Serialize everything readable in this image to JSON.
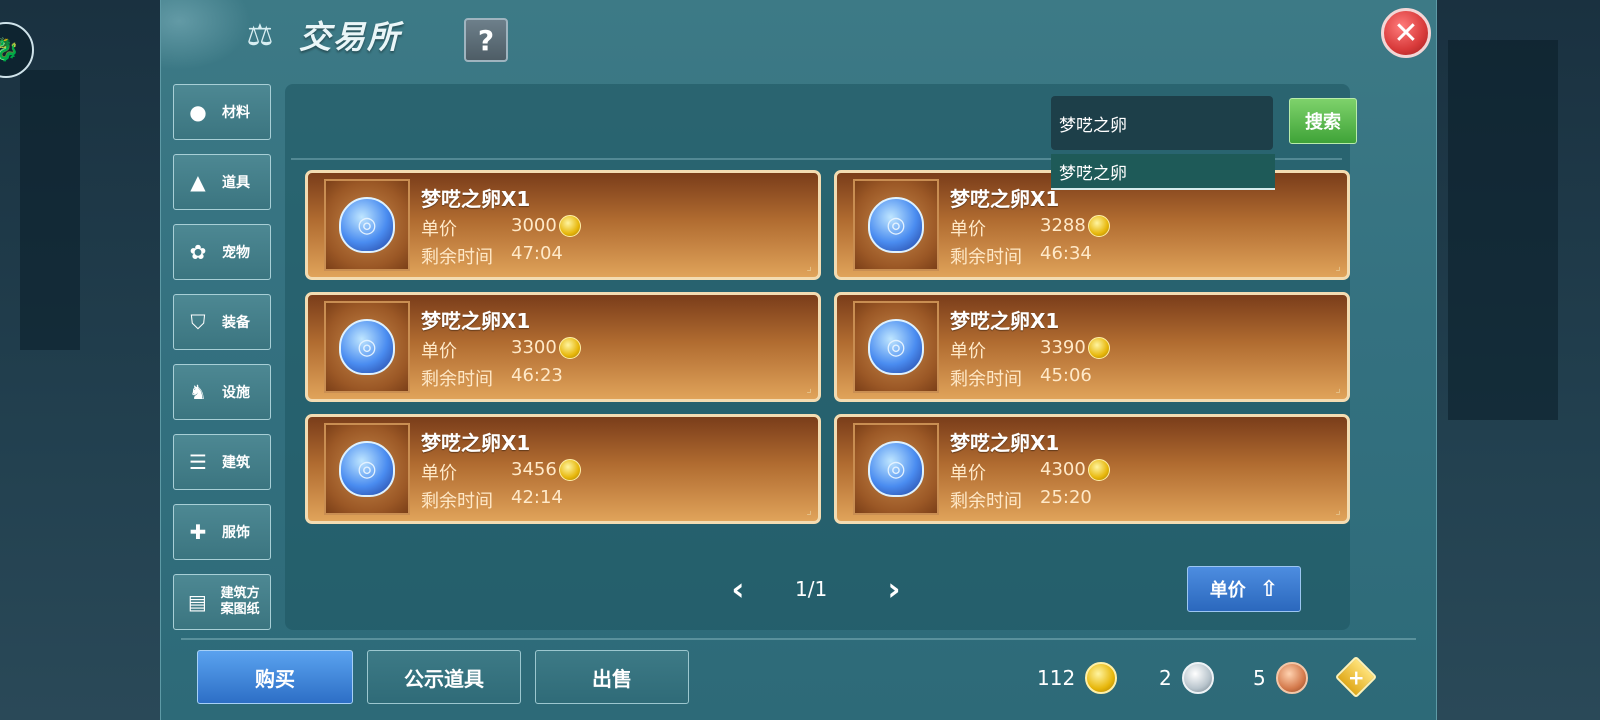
{
  "header": {
    "title": "交易所",
    "help_label": "?",
    "close_label": "✕"
  },
  "categories": [
    {
      "label": "材料",
      "icon": "materials-icon"
    },
    {
      "label": "道具",
      "icon": "item-flask-icon"
    },
    {
      "label": "宠物",
      "icon": "paw-icon"
    },
    {
      "label": "装备",
      "icon": "equipment-icon"
    },
    {
      "label": "设施",
      "icon": "facility-icon"
    },
    {
      "label": "建筑",
      "icon": "building-icon"
    },
    {
      "label": "服饰",
      "icon": "clothing-icon"
    },
    {
      "label": "建筑方案图纸",
      "icon": "blueprint-icon"
    }
  ],
  "search": {
    "value": "梦呓之卵",
    "button_label": "搜索",
    "suggestion": "梦呓之卵"
  },
  "listing_labels": {
    "price_label": "单价",
    "time_label": "剩余时间"
  },
  "listings": [
    {
      "name": "梦呓之卵X1",
      "price": "3000",
      "time": "47:04"
    },
    {
      "name": "梦呓之卵X1",
      "price": "3288",
      "time": "46:34"
    },
    {
      "name": "梦呓之卵X1",
      "price": "3300",
      "time": "46:23"
    },
    {
      "name": "梦呓之卵X1",
      "price": "3390",
      "time": "45:06"
    },
    {
      "name": "梦呓之卵X1",
      "price": "3456",
      "time": "42:14"
    },
    {
      "name": "梦呓之卵X1",
      "price": "4300",
      "time": "25:20"
    }
  ],
  "pagination": {
    "prev": "‹",
    "page": "1/1",
    "next": "›"
  },
  "sort": {
    "label": "单价",
    "icon": "sort-arrow-icon"
  },
  "actions": {
    "buy": "购买",
    "announce": "公示道具",
    "sell": "出售"
  },
  "currency": {
    "gold": "112",
    "silver": "2",
    "copper": "5",
    "add_label": "+"
  }
}
